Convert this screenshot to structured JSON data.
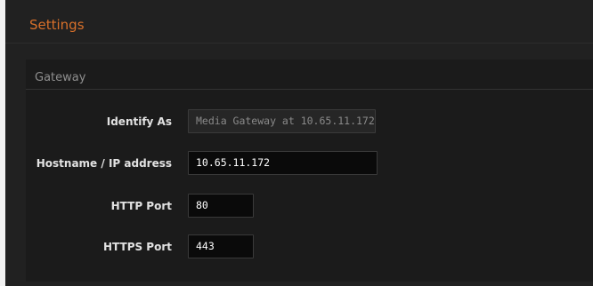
{
  "header": {
    "title": "Settings"
  },
  "gateway": {
    "section_title": "Gateway",
    "fields": [
      {
        "label": "Identify As",
        "value": "Media Gateway at 10.65.11.172"
      },
      {
        "label": "Hostname / IP address",
        "value": "10.65.11.172"
      },
      {
        "label": "HTTP Port",
        "value": "80"
      },
      {
        "label": "HTTPS Port",
        "value": "443"
      }
    ]
  },
  "colors": {
    "accent": "#d8702a",
    "panel_bg": "#212121",
    "section_bg": "#1b1b1b",
    "input_bg": "#0a0a0a",
    "readonly_bg": "#262626"
  }
}
